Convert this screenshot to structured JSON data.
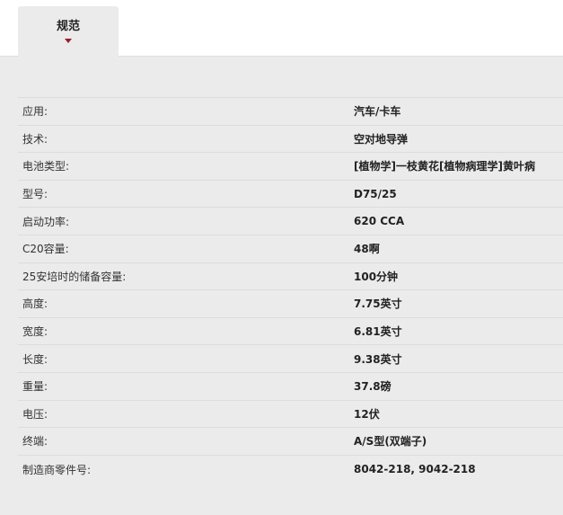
{
  "tabs": [
    {
      "label": "规范",
      "active": true
    }
  ],
  "specs": [
    {
      "label": "应用:",
      "value": "汽车/卡车"
    },
    {
      "label": "技术:",
      "value": "空对地导弹"
    },
    {
      "label": "电池类型:",
      "value": "[植物学]一枝黄花[植物病理学]黄叶病"
    },
    {
      "label": "型号:",
      "value": "D75/25"
    },
    {
      "label": "启动功率:",
      "value": "620 CCA"
    },
    {
      "label": "C20容量:",
      "value": "48啊"
    },
    {
      "label": "25安培时的储备容量:",
      "value": "100分钟"
    },
    {
      "label": "高度:",
      "value": "7.75英寸"
    },
    {
      "label": "宽度:",
      "value": "6.81英寸"
    },
    {
      "label": "长度:",
      "value": "9.38英寸"
    },
    {
      "label": "重量:",
      "value": "37.8磅"
    },
    {
      "label": "电压:",
      "value": "12伏"
    },
    {
      "label": "终端:",
      "value": "A/S型(双端子)"
    },
    {
      "label": "制造商零件号:",
      "value": "8042-218, 9042-218"
    }
  ],
  "colors": {
    "accent": "#9b1c24",
    "background": "#ebebeb",
    "header_background": "#ffffff",
    "row_divider": "#dcdcdc"
  },
  "icons": {
    "tab_indicator": "caret-down-icon"
  }
}
